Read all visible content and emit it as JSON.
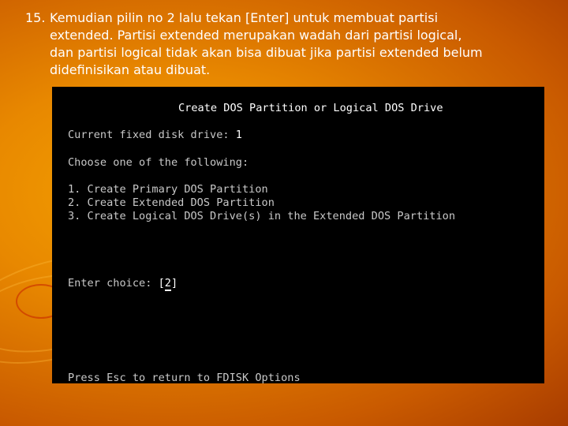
{
  "slide": {
    "number": "15.",
    "instruction_lines": [
      "Kemudian pilin no 2  lalu  tekan  [Enter] untuk membuat partisi",
      "extended. Partisi extended merupakan wadah dari partisi logical,",
      "dan partisi logical tidak akan bisa dibuat jika partisi extended belum",
      "didefinisikan atau dibuat."
    ]
  },
  "dos": {
    "title": "Create DOS Partition or Logical DOS Drive",
    "current_drive_label": "Current fixed disk drive: ",
    "current_drive_value": "1",
    "choose_prompt": "Choose one of the following:",
    "options": [
      "1. Create Primary DOS Partition",
      "2. Create Extended DOS Partition",
      "3. Create Logical DOS Drive(s) in the Extended DOS Partition"
    ],
    "enter_choice_label": "Enter choice: ",
    "choice_open": "[",
    "choice_value": "2",
    "choice_close": "]",
    "footer": "Press Esc to return to FDISK Options"
  },
  "colors": {
    "background_orange": "#e88800",
    "screen_black": "#000000",
    "text_white": "#ffffff",
    "dos_gray": "#c8c8c8"
  }
}
